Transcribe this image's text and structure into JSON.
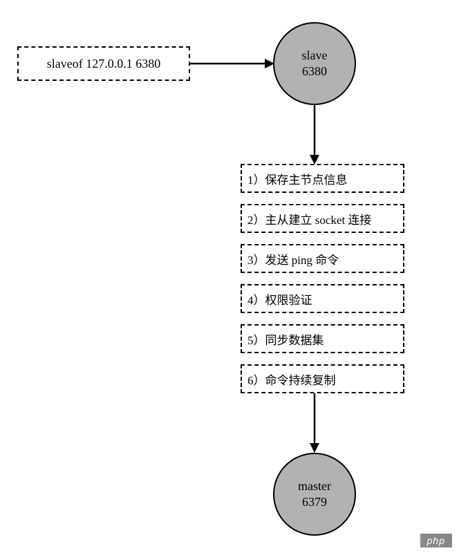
{
  "command": {
    "text": "slaveof 127.0.0.1 6380"
  },
  "nodes": {
    "slave": {
      "label": "slave",
      "port": "6380"
    },
    "master": {
      "label": "master",
      "port": "6379"
    }
  },
  "steps": [
    {
      "num": "1）",
      "text": "保存主节点信息"
    },
    {
      "num": "2）",
      "text": "主从建立 socket 连接"
    },
    {
      "num": "3）",
      "text": "发送 ping 命令"
    },
    {
      "num": "4）",
      "text": "权限验证"
    },
    {
      "num": "5）",
      "text": "同步数据集"
    },
    {
      "num": "6）",
      "text": "命令持续复制"
    }
  ],
  "watermark": "php"
}
